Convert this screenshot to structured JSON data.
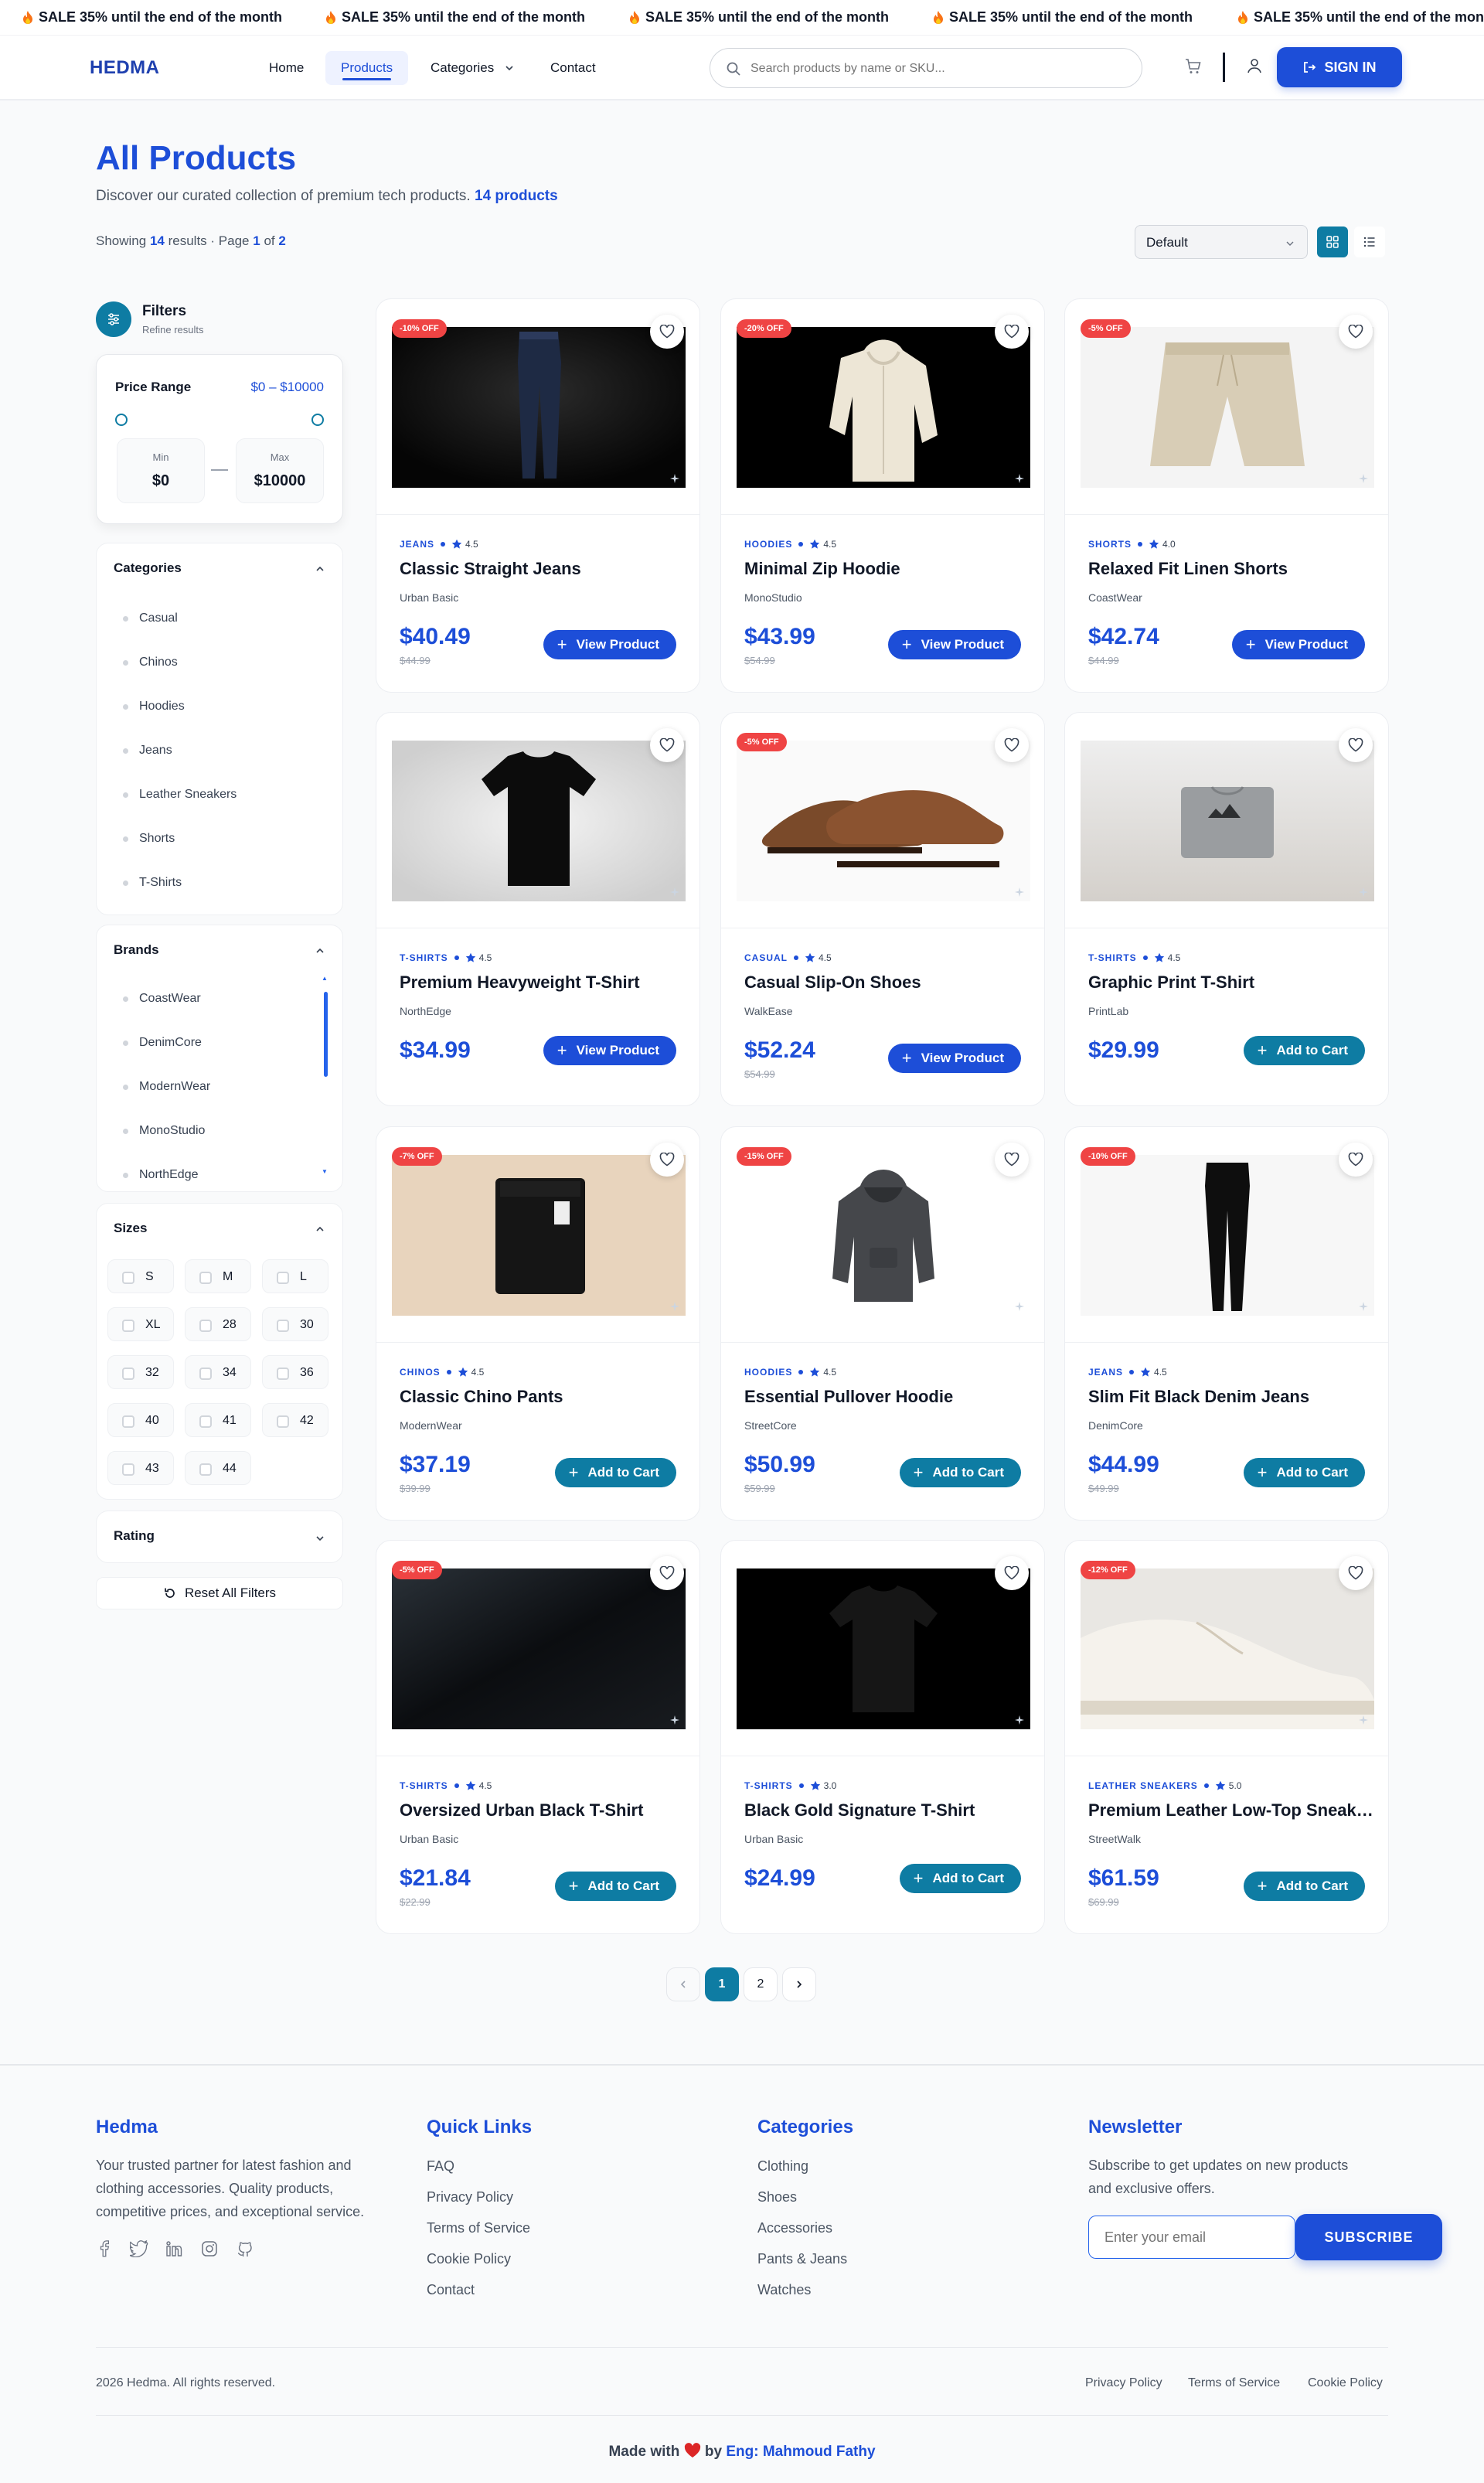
{
  "announcement": {
    "text": "SALE 35% until the end of the month"
  },
  "header": {
    "logo": "HEDMA",
    "nav": [
      "Home",
      "Products",
      "Categories",
      "Contact"
    ],
    "search_placeholder": "Search products by name or SKU...",
    "signin": "SIGN IN"
  },
  "page": {
    "title": "All Products",
    "subtitle": "Discover our curated collection of premium tech products.",
    "count_label": "14 products",
    "showing_prefix": "Showing",
    "showing_count": "14",
    "showing_mid": "results · Page",
    "page_cur": "1",
    "page_of": "of",
    "page_total": "2",
    "sort_value": "Default"
  },
  "sidebar": {
    "title": "Filters",
    "subtitle": "Refine results",
    "price": {
      "label": "Price Range",
      "range": "$0 – $10000",
      "min_label": "Min",
      "min_value": "$0",
      "max_label": "Max",
      "max_value": "$10000"
    },
    "categories": {
      "title": "Categories",
      "items": [
        "Casual",
        "Chinos",
        "Hoodies",
        "Jeans",
        "Leather Sneakers",
        "Shorts",
        "T-Shirts"
      ]
    },
    "brands": {
      "title": "Brands",
      "items": [
        "CoastWear",
        "DenimCore",
        "ModernWear",
        "MonoStudio",
        "NorthEdge"
      ]
    },
    "sizes": {
      "title": "Sizes",
      "items": [
        "S",
        "M",
        "L",
        "XL",
        "28",
        "30",
        "32",
        "34",
        "36",
        "40",
        "41",
        "42",
        "43",
        "44"
      ]
    },
    "rating": {
      "title": "Rating"
    },
    "reset": "Reset All Filters"
  },
  "products": [
    {
      "badge": "-10% OFF",
      "category": "JEANS",
      "rating": "4.5",
      "name": "Classic Straight Jeans",
      "brand": "Urban Basic",
      "price": "$40.49",
      "old_price": "$44.99",
      "button": "View Product",
      "btype": "view",
      "img": "jeans-dark"
    },
    {
      "badge": "-20% OFF",
      "category": "HOODIES",
      "rating": "4.5",
      "name": "Minimal Zip Hoodie",
      "brand": "MonoStudio",
      "price": "$43.99",
      "old_price": "$54.99",
      "button": "View Product",
      "btype": "view",
      "img": "hoodie-cream"
    },
    {
      "badge": "-5% OFF",
      "category": "SHORTS",
      "rating": "4.0",
      "name": "Relaxed Fit Linen Shorts",
      "brand": "CoastWear",
      "price": "$42.74",
      "old_price": "$44.99",
      "button": "View Product",
      "btype": "view",
      "img": "shorts"
    },
    {
      "badge": "",
      "category": "T-SHIRTS",
      "rating": "4.5",
      "name": "Premium Heavyweight T-Shirt",
      "brand": "NorthEdge",
      "price": "$34.99",
      "old_price": "",
      "button": "View Product",
      "btype": "view",
      "img": "tshirt-grey-bg"
    },
    {
      "badge": "-5% OFF",
      "category": "CASUAL",
      "rating": "4.5",
      "name": "Casual Slip-On Shoes",
      "brand": "WalkEase",
      "price": "$52.24",
      "old_price": "$54.99",
      "button": "View Product",
      "btype": "view",
      "img": "shoes"
    },
    {
      "badge": "",
      "category": "T-SHIRTS",
      "rating": "4.5",
      "name": "Graphic Print T-Shirt",
      "brand": "PrintLab",
      "price": "$29.99",
      "old_price": "",
      "button": "Add to Cart",
      "btype": "cart",
      "img": "folded-tee"
    },
    {
      "badge": "-7% OFF",
      "category": "CHINOS",
      "rating": "4.5",
      "name": "Classic Chino Pants",
      "brand": "ModernWear",
      "price": "$37.19",
      "old_price": "$39.99",
      "button": "Add to Cart",
      "btype": "cart",
      "img": "chino"
    },
    {
      "badge": "-15% OFF",
      "category": "HOODIES",
      "rating": "4.5",
      "name": "Essential Pullover Hoodie",
      "brand": "StreetCore",
      "price": "$50.99",
      "old_price": "$59.99",
      "button": "Add to Cart",
      "btype": "cart",
      "img": "hoodie-grey"
    },
    {
      "badge": "-10% OFF",
      "category": "JEANS",
      "rating": "4.5",
      "name": "Slim Fit Black Denim Jeans",
      "brand": "DenimCore",
      "price": "$44.99",
      "old_price": "$49.99",
      "button": "Add to Cart",
      "btype": "cart",
      "img": "jeans-black"
    },
    {
      "badge": "-5% OFF",
      "category": "T-SHIRTS",
      "rating": "4.5",
      "name": "Oversized Urban Black T-Shirt",
      "brand": "Urban Basic",
      "price": "$21.84",
      "old_price": "$22.99",
      "button": "Add to Cart",
      "btype": "cart",
      "img": "fabric"
    },
    {
      "badge": "",
      "category": "T-SHIRTS",
      "rating": "3.0",
      "name": "Black Gold Signature T-Shirt",
      "brand": "Urban Basic",
      "price": "$24.99",
      "old_price": "",
      "button": "Add to Cart",
      "btype": "cart",
      "img": "tshirt-black-bg"
    },
    {
      "badge": "-12% OFF",
      "category": "LEATHER SNEAKERS",
      "rating": "5.0",
      "name": "Premium Leather Low-Top Sneakers",
      "brand": "StreetWalk",
      "price": "$61.59",
      "old_price": "$69.99",
      "button": "Add to Cart",
      "btype": "cart",
      "img": "sneaker"
    }
  ],
  "pagination": {
    "pages": [
      "1",
      "2"
    ],
    "current": "1"
  },
  "footer": {
    "brand": {
      "title": "Hedma",
      "text1": "Your trusted partner for latest fashion and",
      "text2": "clothing accessories. Quality products,",
      "text3": "competitive prices, and exceptional service."
    },
    "quick_links": {
      "title": "Quick Links",
      "items": [
        "FAQ",
        "Privacy Policy",
        "Terms of Service",
        "Cookie Policy",
        "Contact"
      ]
    },
    "categories": {
      "title": "Categories",
      "items": [
        "Clothing",
        "Shoes",
        "Accessories",
        "Pants & Jeans",
        "Watches"
      ]
    },
    "newsletter": {
      "title": "Newsletter",
      "text1": "Subscribe to get updates on new products",
      "text2": "and exclusive offers.",
      "placeholder": "Enter your email",
      "button": "SUBSCRIBE"
    },
    "copyright": "2026 Hedma. All rights reserved.",
    "bottom_links": [
      "Privacy Policy",
      "Terms of Service",
      "Cookie Policy"
    ],
    "made_prefix": "Made with",
    "made_by": "by",
    "made_name": "Eng: Mahmoud Fathy"
  },
  "colors": {
    "primary": "#1d4ed8",
    "teal": "#0e7ca3",
    "badge": "#ef4444"
  }
}
